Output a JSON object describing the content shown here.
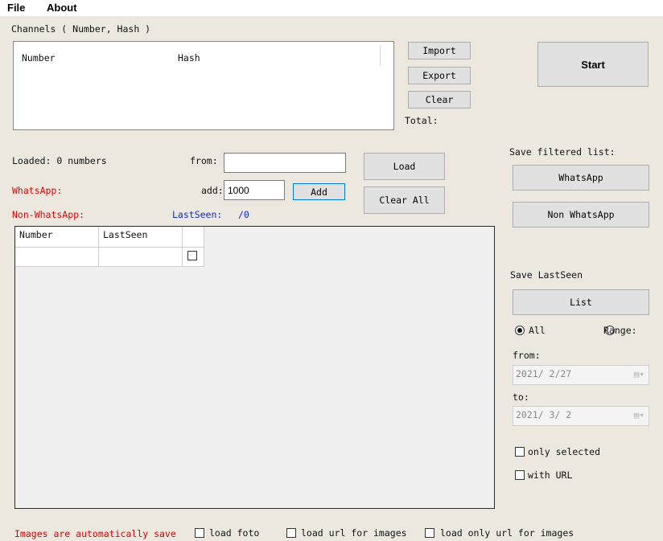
{
  "menu": {
    "file": "File",
    "about": "About"
  },
  "channels": {
    "group_label": "Channels ( Number, Hash )",
    "col_number": "Number",
    "col_hash": "Hash",
    "import_label": "Import",
    "export_label": "Export",
    "clear_label": "Clear",
    "total_label": "Total:"
  },
  "start_label": "Start",
  "load": {
    "loaded_text": "Loaded: 0 numbers",
    "from_label": "from:",
    "from_value": "",
    "add_label": "add:",
    "add_value": "1000",
    "add_button": "Add",
    "load_button": "Load",
    "clear_all_button": "Clear All",
    "whatsapp_label": "WhatsApp:",
    "non_whatsapp_label": "Non-WhatsApp:",
    "lastseen_label": "LastSeen:",
    "lastseen_value": "/0"
  },
  "results_grid": {
    "col_number": "Number",
    "col_lastseen": "LastSeen"
  },
  "save_filtered": {
    "label": "Save filtered list:",
    "whatsapp_button": "WhatsApp",
    "non_whatsapp_button": "Non WhatsApp"
  },
  "save_lastseen": {
    "label": "Save LastSeen",
    "list_button": "List",
    "radio_all": "All",
    "radio_range": "Range:",
    "from_label": "from:",
    "from_date": "2021/ 2/27",
    "to_label": "to:",
    "to_date": "2021/ 3/ 2",
    "only_selected": "only selected",
    "with_url": "with URL"
  },
  "footer": {
    "images_note": "Images are automatically save",
    "load_foto": "load foto",
    "load_url": "load url for images",
    "load_only_url": "load only url for images"
  },
  "colors": {
    "warning_red": "#e00000",
    "lastseen_blue": "#0a2bd6",
    "focus_blue": "#0078d7"
  }
}
